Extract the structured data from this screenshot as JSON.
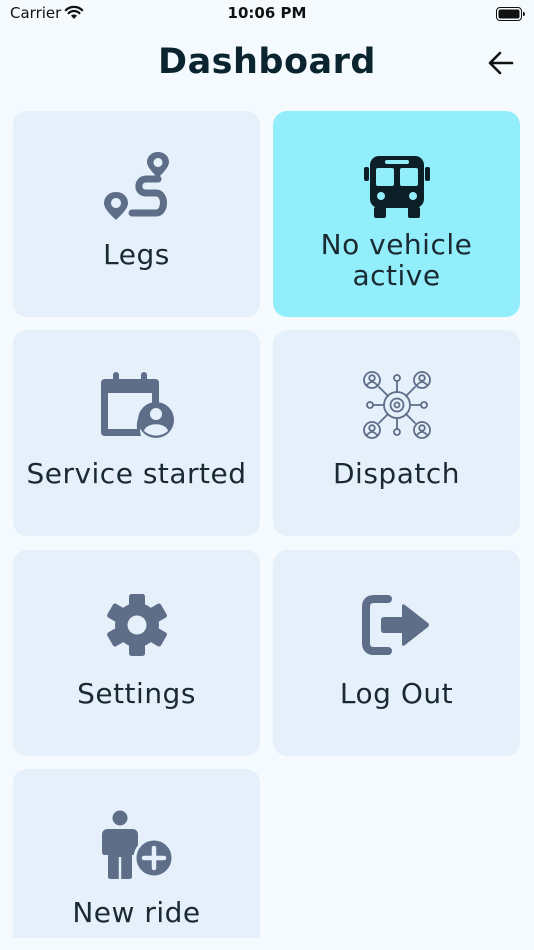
{
  "status_bar": {
    "carrier": "Carrier",
    "time": "10:06 PM"
  },
  "header": {
    "title": "Dashboard"
  },
  "tiles": [
    {
      "label": "Legs",
      "icon": "route-icon"
    },
    {
      "label": "No vehicle active",
      "icon": "bus-icon",
      "active": true
    },
    {
      "label": "Service started",
      "icon": "calendar-user-icon"
    },
    {
      "label": "Dispatch",
      "icon": "dispatch-network-icon"
    },
    {
      "label": "Settings",
      "icon": "gear-icon"
    },
    {
      "label": "Log Out",
      "icon": "logout-icon"
    },
    {
      "label": "New ride",
      "icon": "person-add-icon"
    }
  ],
  "colors": {
    "tile": "#e6f0fa",
    "tile_active": "#93eefb",
    "icon": "#5e6e89",
    "background": "#f4fafd"
  }
}
